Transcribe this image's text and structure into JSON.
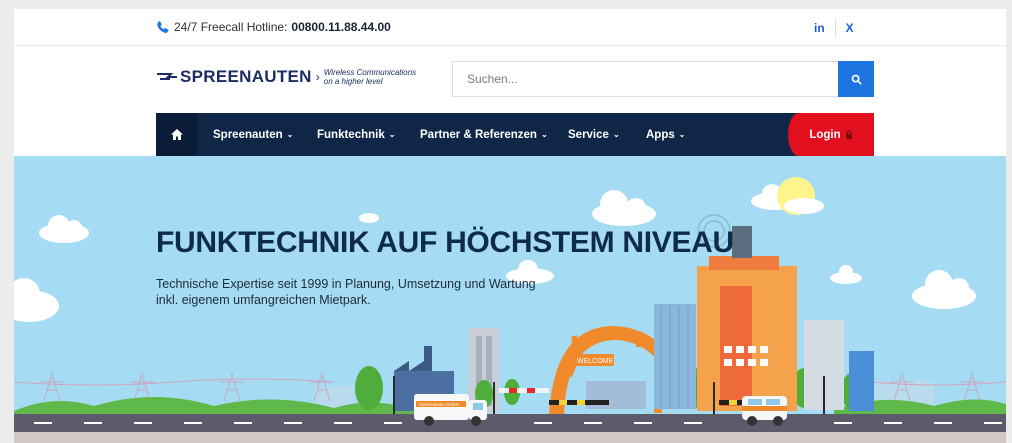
{
  "topbar": {
    "hotline_label": "24/7 Freecall Hotline:",
    "hotline_number": "00800.11.88.44.00",
    "social": [
      {
        "label": "in",
        "icon": "linkedin-icon"
      },
      {
        "label": "X",
        "icon": "xing-icon"
      }
    ]
  },
  "header": {
    "brand": "SPREENAUTEN",
    "tagline_line1": "Wireless Communications",
    "tagline_line2": "on a higher level",
    "search_placeholder": "Suchen..."
  },
  "nav": {
    "items": [
      {
        "label": "Spreenauten"
      },
      {
        "label": "Funktechnik"
      },
      {
        "label": "Partner & Referenzen"
      },
      {
        "label": "Service"
      },
      {
        "label": "Apps"
      }
    ],
    "login_label": "Login",
    "chevron_glyph": "⌄"
  },
  "hero": {
    "title": "FUNKTECHNIK AUF HÖCHSTEM NIVEAU",
    "subtitle_line1": "Technische Expertise seit 1999 in Planung, Umsetzung und Wartung",
    "subtitle_line2": "inkl. eigenem umfangreichen Mietpark.",
    "sign_text": "WELCOME",
    "truck_text": "Spreenauten GmbH"
  },
  "colors": {
    "nav_bg": "#0f2647",
    "login_bg": "#e20f1f",
    "search_button": "#1d75e2",
    "hero_sky": "#a6dcf3",
    "brand_navy": "#1b2e63"
  }
}
